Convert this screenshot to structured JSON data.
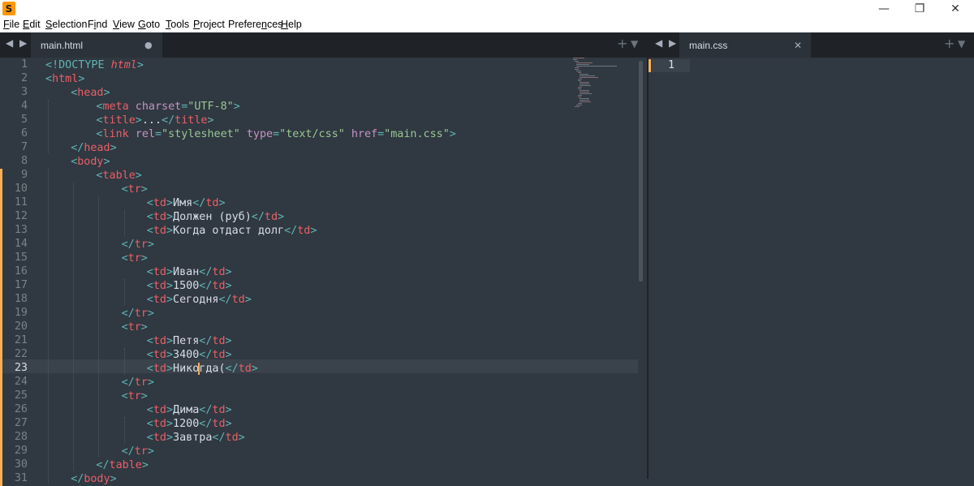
{
  "window": {
    "minimize_glyph": "—",
    "restore_glyph": "❐",
    "close_glyph": "✕"
  },
  "menu": [
    "File",
    "Edit",
    "Selection",
    "Find",
    "View",
    "Goto",
    "Tools",
    "Project",
    "Preferences",
    "Help"
  ],
  "menu_access_keys": [
    "F",
    "E",
    "S",
    "i",
    "V",
    "G",
    "T",
    "P",
    "n",
    "H"
  ],
  "left_pane": {
    "tab_label": "main.html",
    "tab_dirty_glyph": "●",
    "nav_glyph": "◀ ▶",
    "add_glyph": "+",
    "menu_glyph": "▼"
  },
  "right_pane": {
    "tab_label": "main.css",
    "tab_close_glyph": "✕",
    "nav_glyph": "◀ ▶",
    "add_glyph": "+",
    "menu_glyph": "▼",
    "line_number": "1"
  },
  "editor": {
    "active_line": 23,
    "modified_lines_from": 9,
    "lines": [
      {
        "n": "1",
        "indent": 0,
        "tokens": [
          [
            "punc",
            "<"
          ],
          [
            "punc",
            "!DOCTYPE "
          ],
          [
            "kw",
            "html"
          ],
          [
            "punc",
            ">"
          ]
        ]
      },
      {
        "n": "2",
        "indent": 0,
        "tokens": [
          [
            "punc",
            "<"
          ],
          [
            "tag",
            "html"
          ],
          [
            "punc",
            ">"
          ]
        ]
      },
      {
        "n": "3",
        "indent": 1,
        "tokens": [
          [
            "punc",
            "<"
          ],
          [
            "tag",
            "head"
          ],
          [
            "punc",
            ">"
          ]
        ]
      },
      {
        "n": "4",
        "indent": 2,
        "tokens": [
          [
            "punc",
            "<"
          ],
          [
            "tag",
            "meta"
          ],
          [
            "text",
            " "
          ],
          [
            "attr",
            "charset"
          ],
          [
            "punc",
            "="
          ],
          [
            "str",
            "\"UTF-8\""
          ],
          [
            "punc",
            ">"
          ]
        ]
      },
      {
        "n": "5",
        "indent": 2,
        "tokens": [
          [
            "punc",
            "<"
          ],
          [
            "tag",
            "title"
          ],
          [
            "punc",
            ">"
          ],
          [
            "text",
            "..."
          ],
          [
            "punc",
            "</"
          ],
          [
            "tag",
            "title"
          ],
          [
            "punc",
            ">"
          ]
        ]
      },
      {
        "n": "6",
        "indent": 2,
        "tokens": [
          [
            "punc",
            "<"
          ],
          [
            "tag",
            "link"
          ],
          [
            "text",
            " "
          ],
          [
            "attr",
            "rel"
          ],
          [
            "punc",
            "="
          ],
          [
            "str",
            "\"stylesheet\""
          ],
          [
            "text",
            " "
          ],
          [
            "attr",
            "type"
          ],
          [
            "punc",
            "="
          ],
          [
            "str",
            "\"text/css\""
          ],
          [
            "text",
            " "
          ],
          [
            "attr",
            "href"
          ],
          [
            "punc",
            "="
          ],
          [
            "str",
            "\"main.css\""
          ],
          [
            "punc",
            ">"
          ]
        ]
      },
      {
        "n": "7",
        "indent": 1,
        "tokens": [
          [
            "punc",
            "</"
          ],
          [
            "tag",
            "head"
          ],
          [
            "punc",
            ">"
          ]
        ]
      },
      {
        "n": "8",
        "indent": 1,
        "tokens": [
          [
            "punc",
            "<"
          ],
          [
            "tag",
            "body"
          ],
          [
            "punc",
            ">"
          ]
        ]
      },
      {
        "n": "9",
        "indent": 2,
        "tokens": [
          [
            "punc",
            "<"
          ],
          [
            "tag",
            "table"
          ],
          [
            "punc",
            ">"
          ]
        ]
      },
      {
        "n": "10",
        "indent": 3,
        "tokens": [
          [
            "punc",
            "<"
          ],
          [
            "tag",
            "tr"
          ],
          [
            "punc",
            ">"
          ]
        ]
      },
      {
        "n": "11",
        "indent": 4,
        "tokens": [
          [
            "punc",
            "<"
          ],
          [
            "tag",
            "td"
          ],
          [
            "punc",
            ">"
          ],
          [
            "text",
            "Имя"
          ],
          [
            "punc",
            "</"
          ],
          [
            "tag",
            "td"
          ],
          [
            "punc",
            ">"
          ]
        ]
      },
      {
        "n": "12",
        "indent": 4,
        "tokens": [
          [
            "punc",
            "<"
          ],
          [
            "tag",
            "td"
          ],
          [
            "punc",
            ">"
          ],
          [
            "text",
            "Должен (руб)"
          ],
          [
            "punc",
            "</"
          ],
          [
            "tag",
            "td"
          ],
          [
            "punc",
            ">"
          ]
        ]
      },
      {
        "n": "13",
        "indent": 4,
        "tokens": [
          [
            "punc",
            "<"
          ],
          [
            "tag",
            "td"
          ],
          [
            "punc",
            ">"
          ],
          [
            "text",
            "Когда отдаст долг"
          ],
          [
            "punc",
            "</"
          ],
          [
            "tag",
            "td"
          ],
          [
            "punc",
            ">"
          ]
        ]
      },
      {
        "n": "14",
        "indent": 3,
        "tokens": [
          [
            "punc",
            "</"
          ],
          [
            "tag",
            "tr"
          ],
          [
            "punc",
            ">"
          ]
        ]
      },
      {
        "n": "15",
        "indent": 3,
        "tokens": [
          [
            "punc",
            "<"
          ],
          [
            "tag",
            "tr"
          ],
          [
            "punc",
            ">"
          ]
        ]
      },
      {
        "n": "16",
        "indent": 4,
        "tokens": [
          [
            "punc",
            "<"
          ],
          [
            "tag",
            "td"
          ],
          [
            "punc",
            ">"
          ],
          [
            "text",
            "Иван"
          ],
          [
            "punc",
            "</"
          ],
          [
            "tag",
            "td"
          ],
          [
            "punc",
            ">"
          ]
        ]
      },
      {
        "n": "17",
        "indent": 4,
        "tokens": [
          [
            "punc",
            "<"
          ],
          [
            "tag",
            "td"
          ],
          [
            "punc",
            ">"
          ],
          [
            "text",
            "1500"
          ],
          [
            "punc",
            "</"
          ],
          [
            "tag",
            "td"
          ],
          [
            "punc",
            ">"
          ]
        ]
      },
      {
        "n": "18",
        "indent": 4,
        "tokens": [
          [
            "punc",
            "<"
          ],
          [
            "tag",
            "td"
          ],
          [
            "punc",
            ">"
          ],
          [
            "text",
            "Сегодня"
          ],
          [
            "punc",
            "</"
          ],
          [
            "tag",
            "td"
          ],
          [
            "punc",
            ">"
          ]
        ]
      },
      {
        "n": "19",
        "indent": 3,
        "tokens": [
          [
            "punc",
            "</"
          ],
          [
            "tag",
            "tr"
          ],
          [
            "punc",
            ">"
          ]
        ]
      },
      {
        "n": "20",
        "indent": 3,
        "tokens": [
          [
            "punc",
            "<"
          ],
          [
            "tag",
            "tr"
          ],
          [
            "punc",
            ">"
          ]
        ]
      },
      {
        "n": "21",
        "indent": 4,
        "tokens": [
          [
            "punc",
            "<"
          ],
          [
            "tag",
            "td"
          ],
          [
            "punc",
            ">"
          ],
          [
            "text",
            "Петя"
          ],
          [
            "punc",
            "</"
          ],
          [
            "tag",
            "td"
          ],
          [
            "punc",
            ">"
          ]
        ]
      },
      {
        "n": "22",
        "indent": 4,
        "tokens": [
          [
            "punc",
            "<"
          ],
          [
            "tag",
            "td"
          ],
          [
            "punc",
            ">"
          ],
          [
            "text",
            "3400"
          ],
          [
            "punc",
            "</"
          ],
          [
            "tag",
            "td"
          ],
          [
            "punc",
            ">"
          ]
        ]
      },
      {
        "n": "23",
        "indent": 4,
        "tokens": [
          [
            "punc",
            "<"
          ],
          [
            "tag",
            "td"
          ],
          [
            "punc",
            ">"
          ],
          [
            "text",
            "Нико"
          ],
          [
            "cursor",
            ""
          ],
          [
            "text",
            "гда("
          ],
          [
            "punc",
            "</"
          ],
          [
            "tag",
            "td"
          ],
          [
            "punc",
            ">"
          ]
        ]
      },
      {
        "n": "24",
        "indent": 3,
        "tokens": [
          [
            "punc",
            "</"
          ],
          [
            "tag",
            "tr"
          ],
          [
            "punc",
            ">"
          ]
        ]
      },
      {
        "n": "25",
        "indent": 3,
        "tokens": [
          [
            "punc",
            "<"
          ],
          [
            "tag",
            "tr"
          ],
          [
            "punc",
            ">"
          ]
        ]
      },
      {
        "n": "26",
        "indent": 4,
        "tokens": [
          [
            "punc",
            "<"
          ],
          [
            "tag",
            "td"
          ],
          [
            "punc",
            ">"
          ],
          [
            "text",
            "Дима"
          ],
          [
            "punc",
            "</"
          ],
          [
            "tag",
            "td"
          ],
          [
            "punc",
            ">"
          ]
        ]
      },
      {
        "n": "27",
        "indent": 4,
        "tokens": [
          [
            "punc",
            "<"
          ],
          [
            "tag",
            "td"
          ],
          [
            "punc",
            ">"
          ],
          [
            "text",
            "1200"
          ],
          [
            "punc",
            "</"
          ],
          [
            "tag",
            "td"
          ],
          [
            "punc",
            ">"
          ]
        ]
      },
      {
        "n": "28",
        "indent": 4,
        "tokens": [
          [
            "punc",
            "<"
          ],
          [
            "tag",
            "td"
          ],
          [
            "punc",
            ">"
          ],
          [
            "text",
            "Завтра"
          ],
          [
            "punc",
            "</"
          ],
          [
            "tag",
            "td"
          ],
          [
            "punc",
            ">"
          ]
        ]
      },
      {
        "n": "29",
        "indent": 3,
        "tokens": [
          [
            "punc",
            "</"
          ],
          [
            "tag",
            "tr"
          ],
          [
            "punc",
            ">"
          ]
        ]
      },
      {
        "n": "30",
        "indent": 2,
        "tokens": [
          [
            "punc",
            "</"
          ],
          [
            "tag",
            "table"
          ],
          [
            "punc",
            ">"
          ]
        ]
      },
      {
        "n": "31",
        "indent": 1,
        "tokens": [
          [
            "punc",
            "</"
          ],
          [
            "tag",
            "body"
          ],
          [
            "punc",
            ">"
          ]
        ]
      }
    ]
  },
  "colors": {
    "background": "#303841",
    "tag": "#ec5f66",
    "punctuation": "#5fb4b4",
    "attribute": "#c594c5",
    "string": "#99c794",
    "text": "#d8dee9",
    "cursor": "#f9ae58"
  }
}
